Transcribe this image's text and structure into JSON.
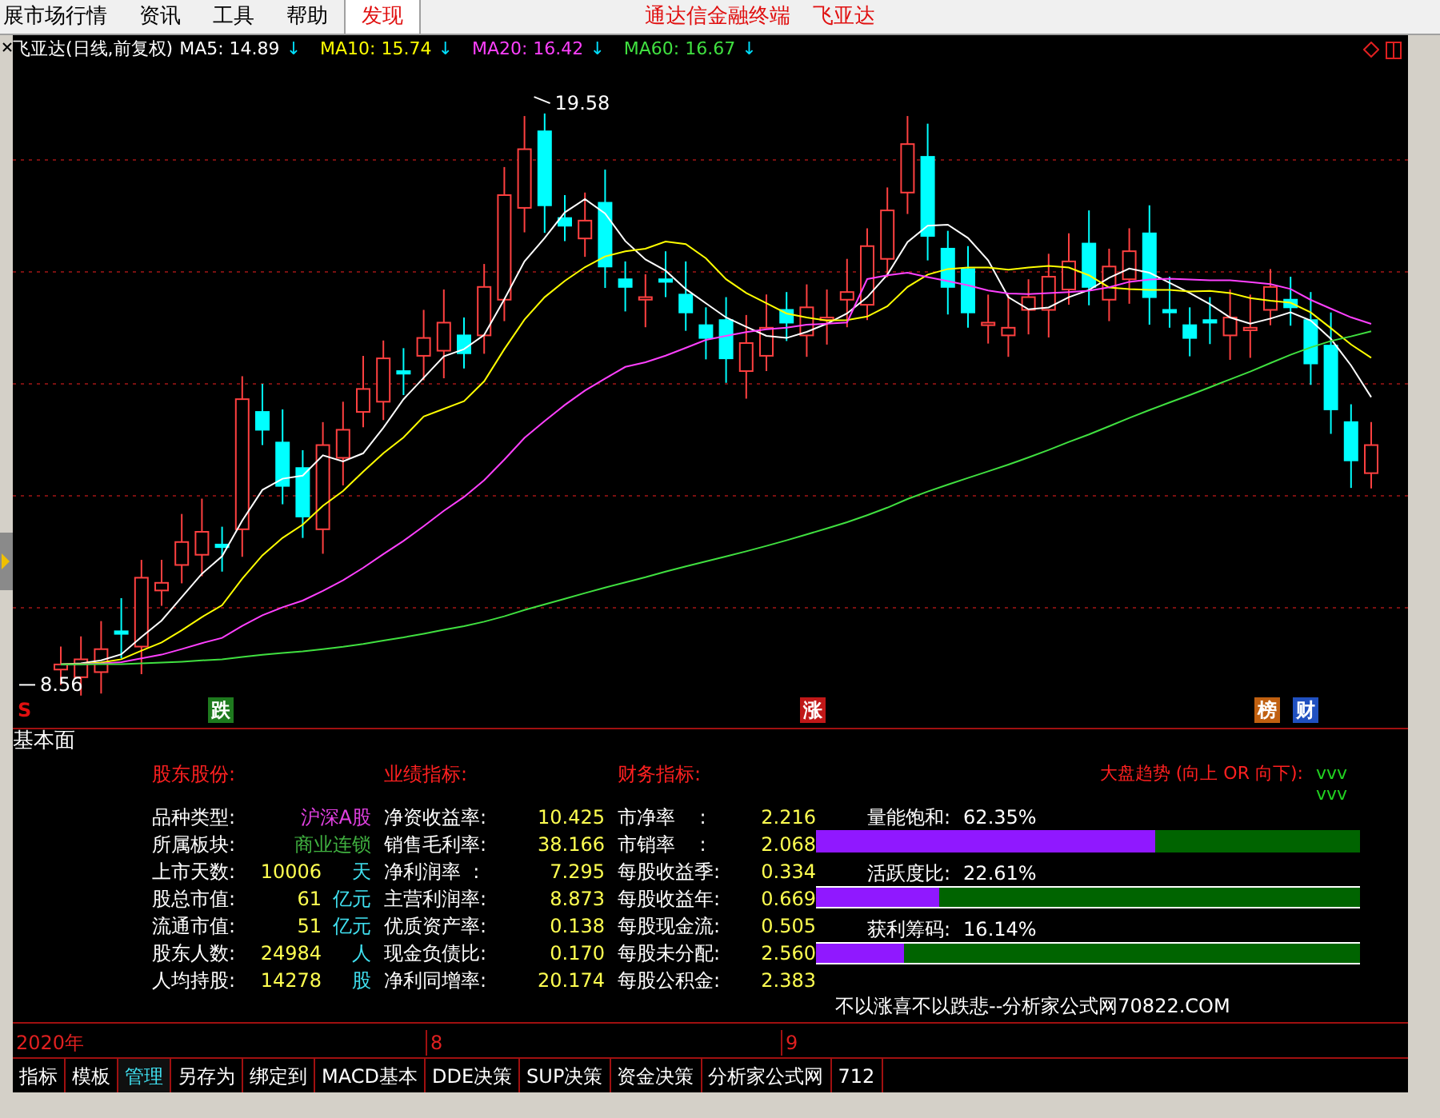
{
  "menu": {
    "items": [
      {
        "label": "展市场行情",
        "highlighted": false
      },
      {
        "label": "资讯",
        "highlighted": false
      },
      {
        "label": "工具",
        "highlighted": false
      },
      {
        "label": "帮助",
        "highlighted": false
      },
      {
        "label": "发现",
        "highlighted": true
      }
    ],
    "right": [
      "通达信金融终端",
      "飞亚达"
    ]
  },
  "chart": {
    "title": "飞亚达(日线,前复权)",
    "ma": [
      {
        "label": "MA5: 14.89",
        "trend": "↓",
        "color": "#ffffff"
      },
      {
        "label": "MA10: 15.74",
        "trend": "↓",
        "color": "#ffff00"
      },
      {
        "label": "MA20: 16.42",
        "trend": "↓",
        "color": "#ff40ff"
      },
      {
        "label": "MA60: 16.67",
        "trend": "↓",
        "color": "#40e040"
      }
    ],
    "high_label": "19.58",
    "low_label": "8.56",
    "markers": [
      {
        "text": "S",
        "color": "#e01010"
      },
      {
        "text": "跌",
        "color": "#1e7a1e"
      },
      {
        "text": "涨",
        "color": "#c01818"
      },
      {
        "text": "榜",
        "color": "#c06010"
      },
      {
        "text": "财",
        "color": "#2050c0"
      }
    ]
  },
  "panel": {
    "title": "基本面",
    "headers": [
      "股东股份:",
      "业绩指标:",
      "财务指标:"
    ],
    "column_1": [
      {
        "label": "品种类型:",
        "value": "沪深A股",
        "color": "#e040e0"
      },
      {
        "label": "所属板块:",
        "value": "商业连锁",
        "color": "#40b040"
      },
      {
        "label": "上市天数:",
        "value": "10006",
        "unit": "天",
        "color": "#ffff50"
      },
      {
        "label": "股总市值:",
        "value": "61",
        "unit": "亿元",
        "color": "#ffff50"
      },
      {
        "label": "流通市值:",
        "value": "51",
        "unit": "亿元",
        "color": "#ffff50"
      },
      {
        "label": "股东人数:",
        "value": "24984",
        "unit": "人",
        "color": "#ffff50"
      },
      {
        "label": "人均持股:",
        "value": "14278",
        "unit": "股",
        "color": "#ffff50"
      }
    ],
    "column_2": [
      {
        "label": "净资收益率:",
        "value": "10.425"
      },
      {
        "label": "销售毛利率:",
        "value": "38.166"
      },
      {
        "label": "净利润率  :",
        "value": "7.295"
      },
      {
        "label": "主营利润率:",
        "value": "8.873"
      },
      {
        "label": "优质资产率:",
        "value": "0.138"
      },
      {
        "label": "现金负债比:",
        "value": "0.170"
      },
      {
        "label": "净利同增率:",
        "value": "20.174"
      }
    ],
    "column_3": [
      {
        "label": "市净率    :",
        "value": "2.216"
      },
      {
        "label": "市销率    :",
        "value": "2.068"
      },
      {
        "label": "每股收益季:",
        "value": "0.334"
      },
      {
        "label": "每股收益年:",
        "value": "0.669"
      },
      {
        "label": "每股现金流:",
        "value": "0.505"
      },
      {
        "label": "每股未分配:",
        "value": "2.560"
      },
      {
        "label": "每股公积金:",
        "value": "2.383"
      }
    ],
    "trend_label": "大盘趋势 (向上 OR 向下):",
    "trend_marks": [
      "vvv",
      "vvv"
    ],
    "meters": [
      {
        "label": "量能饱和:",
        "reading": "62.35%",
        "level": 0.6235
      },
      {
        "label": "活跃度比:",
        "reading": "22.61%",
        "level": 0.2261
      },
      {
        "label": "获利筹码:",
        "reading": "16.14%",
        "level": 0.1614
      }
    ],
    "footer": "不以涨喜不以跌悲--分析家公式网70822.COM"
  },
  "axis": [
    "2020年",
    "8",
    "9"
  ],
  "tabs": [
    {
      "label": "指标",
      "selected": false
    },
    {
      "label": "模板",
      "selected": false
    },
    {
      "label": "管理",
      "selected": true
    },
    {
      "label": "另存为",
      "selected": false
    },
    {
      "label": "绑定到",
      "selected": false
    },
    {
      "label": "MACD基本",
      "selected": false
    },
    {
      "label": "DDE决策",
      "selected": false
    },
    {
      "label": "SUP决策",
      "selected": false
    },
    {
      "label": "资金决策",
      "selected": false
    },
    {
      "label": "分析家公式网",
      "selected": false
    },
    {
      "label": "712",
      "selected": false
    }
  ]
}
